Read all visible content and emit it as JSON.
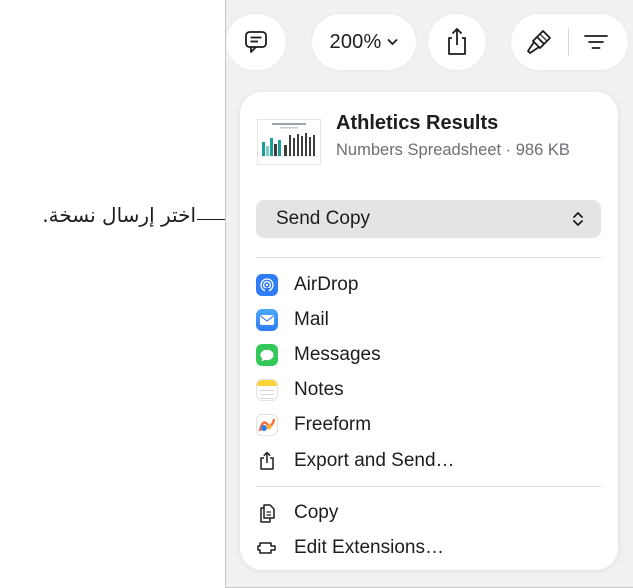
{
  "toolbar": {
    "comment_icon": "comment-icon",
    "zoom_label": "200%",
    "share_icon": "share-icon",
    "format_icon": "paintbrush-icon",
    "organize_icon": "organize-lines-icon"
  },
  "document": {
    "title": "Athletics Results",
    "subtitle": "Numbers Spreadsheet · 986 KB"
  },
  "send_select": {
    "value": "Send Copy"
  },
  "share_targets": [
    {
      "label": "AirDrop",
      "icon": "airdrop-icon"
    },
    {
      "label": "Mail",
      "icon": "mail-icon"
    },
    {
      "label": "Messages",
      "icon": "messages-icon"
    },
    {
      "label": "Notes",
      "icon": "notes-icon"
    },
    {
      "label": "Freeform",
      "icon": "freeform-icon"
    },
    {
      "label": "Export and Send…",
      "icon": "export-icon"
    }
  ],
  "actions": [
    {
      "label": "Copy",
      "icon": "copy-icon"
    },
    {
      "label": "Edit Extensions…",
      "icon": "extensions-icon"
    }
  ],
  "callout": {
    "text": "اختر إرسال نسخة."
  },
  "colors": {
    "airdrop": "#2f7cf6",
    "mail": "#3b8ef5",
    "messages": "#34c759",
    "notes": "#ffd43b",
    "select_bg": "#e4e4e6"
  }
}
